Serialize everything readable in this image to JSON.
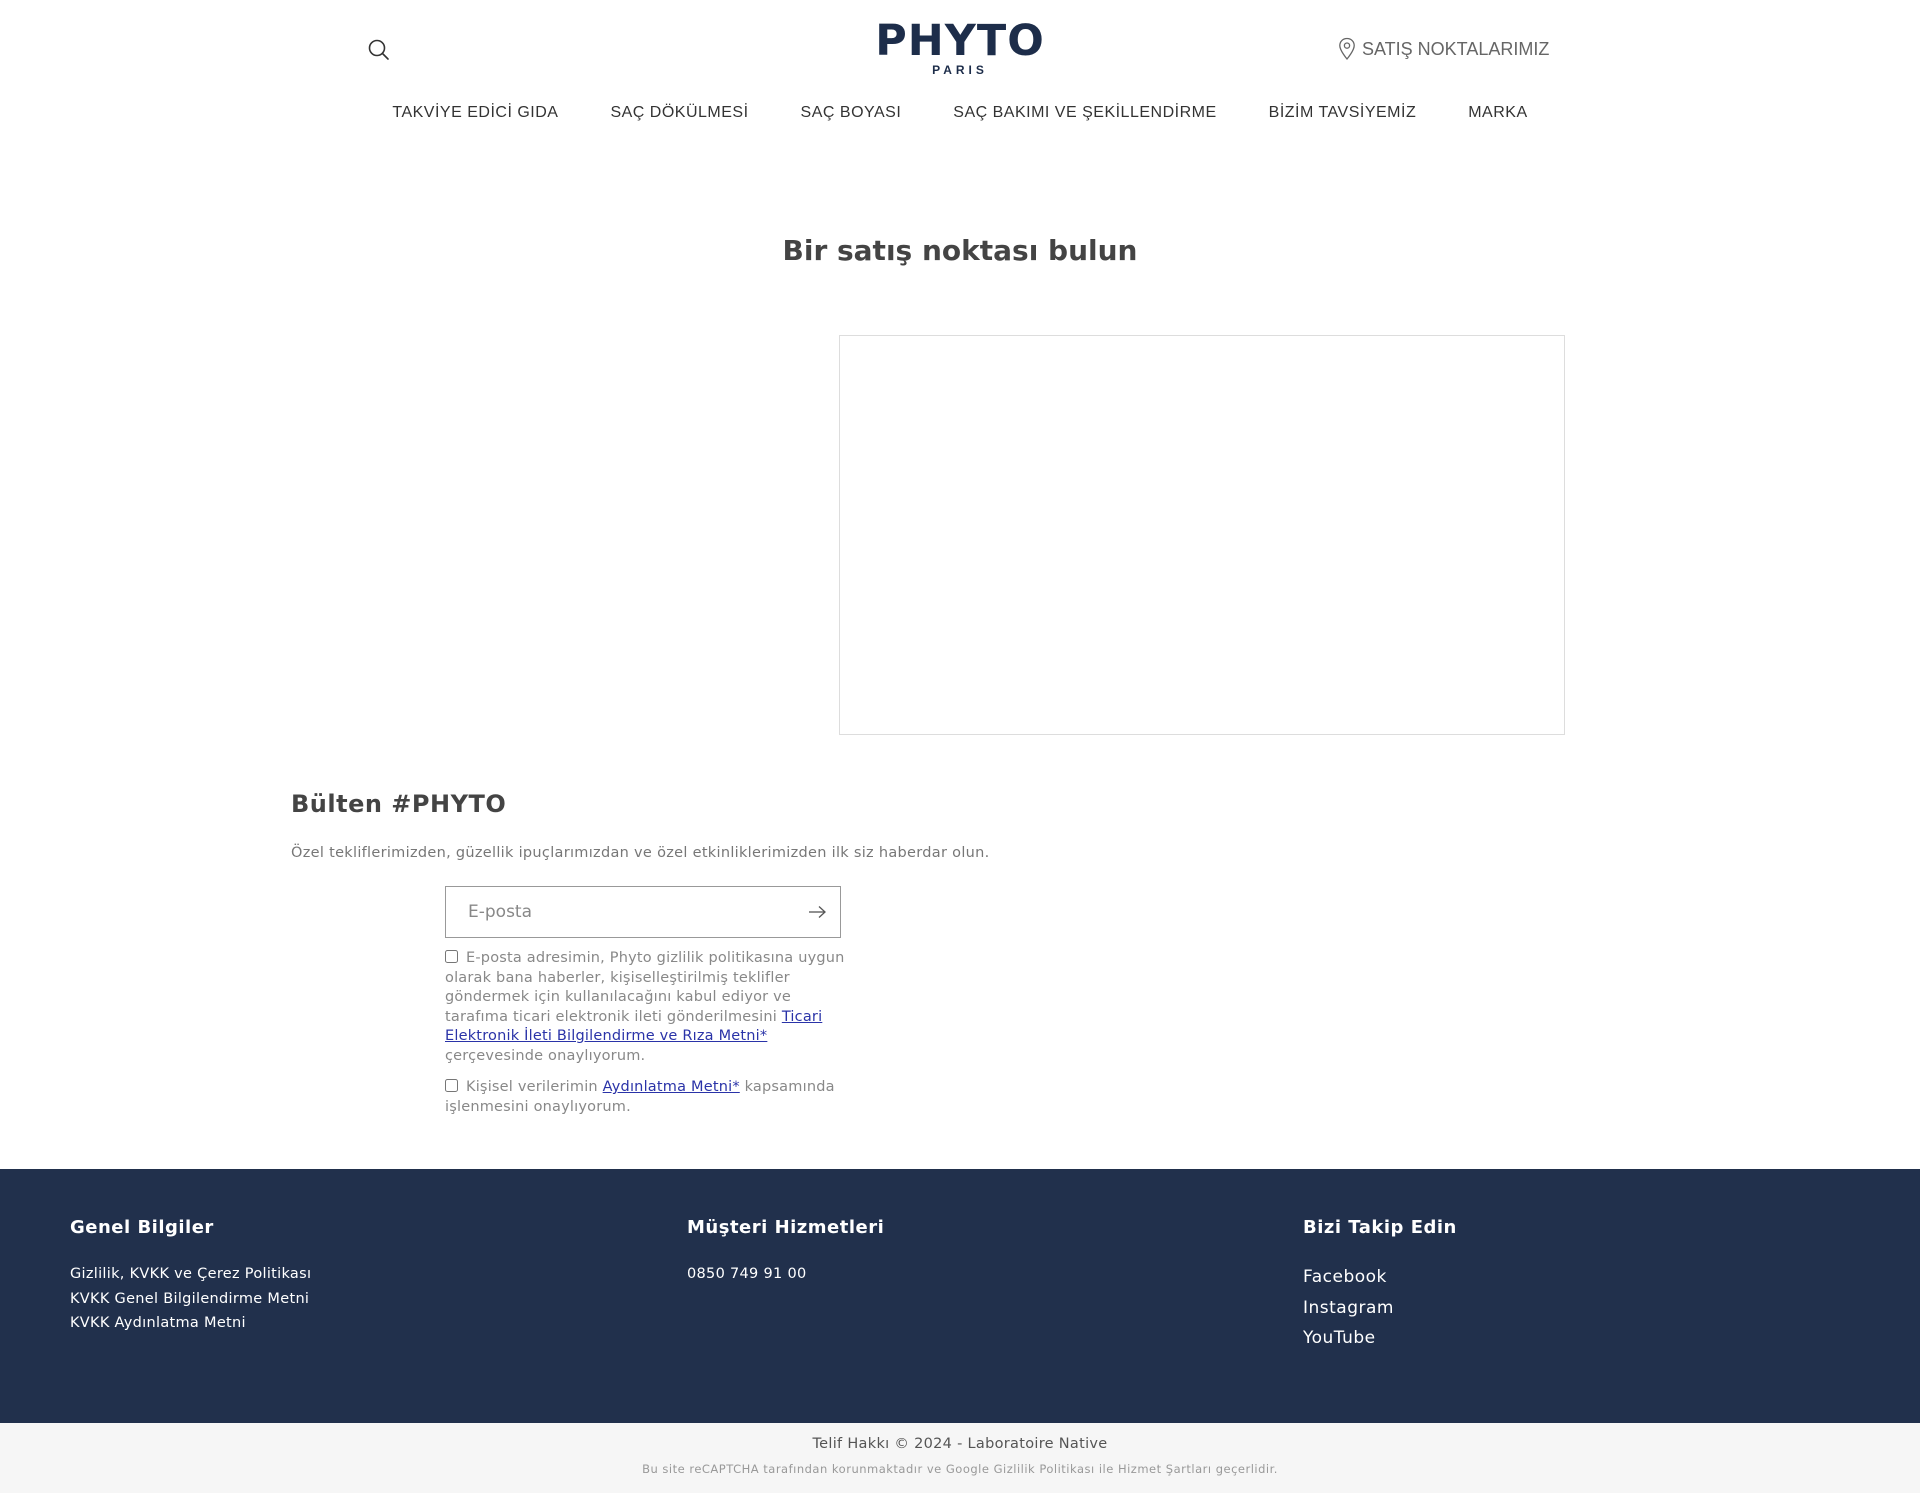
{
  "header": {
    "logo": {
      "main": "PHYTO",
      "sub": "PARIS"
    },
    "stores_link": "SATIŞ NOKTALARIMIZ",
    "nav": [
      {
        "label": "TAKVİYE EDİCİ GIDA"
      },
      {
        "label": "SAÇ DÖKÜLMESİ"
      },
      {
        "label": "SAÇ BOYASI"
      },
      {
        "label": "SAÇ BAKIMI VE ŞEKİLLENDİRME"
      },
      {
        "label": "BİZİM TAVSİYEMİZ"
      },
      {
        "label": "MARKA"
      }
    ]
  },
  "main": {
    "title": "Bir satış noktası bulun"
  },
  "newsletter": {
    "title": "Bülten #PHYTO",
    "description": "Özel tekliflerimizden, güzellik ipuçlarımızdan ve özel etkinliklerimizden ilk siz haberdar olun.",
    "email_placeholder": "E-posta",
    "consent1_text_before": "E-posta adresimin, Phyto gizlilik politikasına uygun olarak bana haberler, kişiselleştirilmiş teklifler göndermek için kullanılacağını kabul ediyor ve tarafıma ticari elektronik ileti gönderilmesini ",
    "consent1_link": "Ticari Elektronik İleti Bilgilendirme ve Rıza Metni*",
    "consent1_text_after": " çerçevesinde onaylıyorum.",
    "consent2_text_before": "Kişisel verilerimin ",
    "consent2_link": "Aydınlatma Metni*",
    "consent2_text_after": " kapsamında işlenmesini onaylıyorum."
  },
  "footer": {
    "general": {
      "title": "Genel Bilgiler",
      "links": [
        "Gizlilik, KVKK ve Çerez Politikası",
        "KVKK Genel Bilgilendirme Metni",
        "KVKK Aydınlatma Metni"
      ]
    },
    "customer": {
      "title": "Müşteri Hizmetleri",
      "phone": "0850 749 91 00"
    },
    "social": {
      "title": "Bizi Takip Edin",
      "links": [
        "Facebook",
        "Instagram",
        "YouTube"
      ]
    },
    "copyright": "Telif Hakkı © 2024 - Laboratoire Native",
    "recaptcha": "Bu site reCAPTCHA tarafından korunmaktadır ve Google Gizlilik Politikası ile Hizmet Şartları geçerlidir."
  },
  "colors": {
    "brand_navy": "#1d2d4a",
    "footer_bg": "#21304c",
    "link_blue": "#2a33a8"
  }
}
